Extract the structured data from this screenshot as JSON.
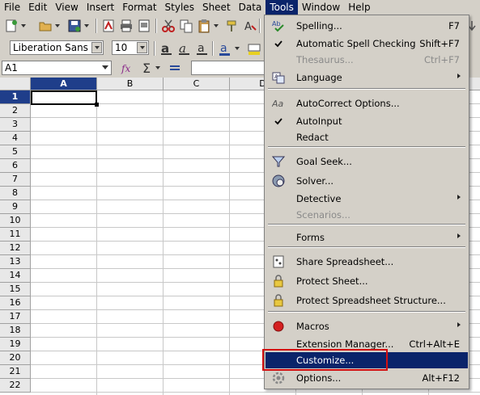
{
  "menubar": [
    "File",
    "Edit",
    "View",
    "Insert",
    "Format",
    "Styles",
    "Sheet",
    "Data",
    "Tools",
    "Window",
    "Help"
  ],
  "active_menu": "Tools",
  "font_name": "Liberation Sans",
  "font_size": "10",
  "name_box": "A1",
  "columns": [
    "A",
    "B",
    "C",
    "D"
  ],
  "rows": [
    "1",
    "2",
    "3",
    "4",
    "5",
    "6",
    "7",
    "8",
    "9",
    "10",
    "11",
    "12",
    "13",
    "14",
    "15",
    "16",
    "17",
    "18",
    "19",
    "20",
    "21",
    "22"
  ],
  "selected_cell": "A1",
  "tools_menu": {
    "items": [
      {
        "label": "Spelling...",
        "shortcut": "F7",
        "icon": "spelling-icon"
      },
      {
        "label": "Automatic Spell Checking",
        "shortcut": "Shift+F7",
        "icon": "check-icon",
        "checked": true
      },
      {
        "label": "Thesaurus...",
        "shortcut": "Ctrl+F7",
        "disabled": true
      },
      {
        "label": "Language",
        "submenu": true,
        "icon": "language-icon"
      },
      {
        "label": "AutoCorrect Options...",
        "icon": "autocorrect-icon"
      },
      {
        "label": "AutoInput",
        "icon": "check-icon",
        "checked": true
      },
      {
        "label": "Redact"
      },
      {
        "label": "Goal Seek...",
        "icon": "goal-seek-icon"
      },
      {
        "label": "Solver...",
        "icon": "solver-icon"
      },
      {
        "label": "Detective",
        "submenu": true
      },
      {
        "label": "Scenarios...",
        "disabled": true
      },
      {
        "label": "Forms",
        "submenu": true
      },
      {
        "label": "Share Spreadsheet...",
        "icon": "share-icon"
      },
      {
        "label": "Protect Sheet...",
        "icon": "lock-icon"
      },
      {
        "label": "Protect Spreadsheet Structure...",
        "icon": "lock-icon"
      },
      {
        "label": "Macros",
        "submenu": true,
        "icon": "macro-record-icon"
      },
      {
        "label": "Extension Manager...",
        "shortcut": "Ctrl+Alt+E"
      },
      {
        "label": "Customize...",
        "highlighted": true
      },
      {
        "label": "Options...",
        "shortcut": "Alt+F12",
        "icon": "options-gear-icon"
      }
    ]
  },
  "colors": {
    "menu_highlight": "#0a246a",
    "callout_box": "#d41010",
    "selected_header": "#1f3e8a"
  }
}
